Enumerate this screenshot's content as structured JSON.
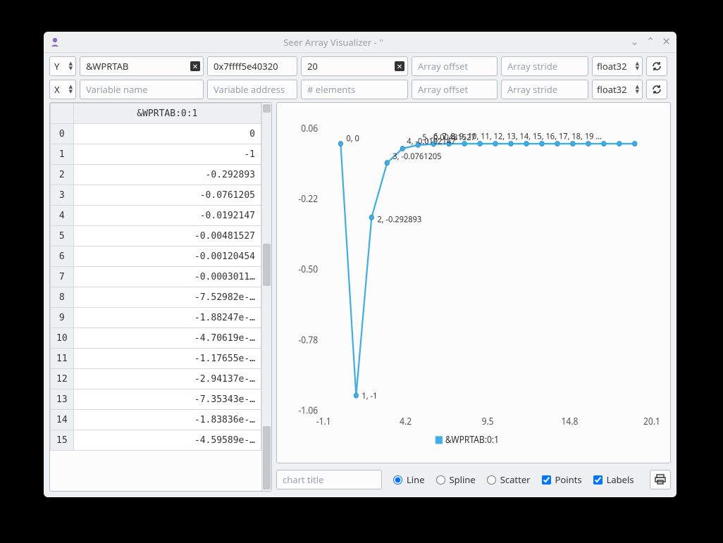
{
  "window": {
    "title": "Seer Array Visualizer - ''"
  },
  "toolbar": {
    "y": {
      "axis_label": "Y",
      "variable": "&WPRTAB",
      "address": "0x7ffff5e40320",
      "elements": "20",
      "offset_placeholder": "Array offset",
      "stride_placeholder": "Array stride",
      "dtype": "float32"
    },
    "x": {
      "axis_label": "X",
      "variable_placeholder": "Variable name",
      "address_placeholder": "Variable address",
      "elements_placeholder": "# elements",
      "offset_placeholder": "Array offset",
      "stride_placeholder": "Array stride",
      "dtype": "float32"
    }
  },
  "table": {
    "column_header": "&WPRTAB:0:1",
    "rows": [
      {
        "idx": 0,
        "val": "0"
      },
      {
        "idx": 1,
        "val": "-1"
      },
      {
        "idx": 2,
        "val": "-0.292893"
      },
      {
        "idx": 3,
        "val": "-0.0761205"
      },
      {
        "idx": 4,
        "val": "-0.0192147"
      },
      {
        "idx": 5,
        "val": "-0.00481527"
      },
      {
        "idx": 6,
        "val": "-0.00120454"
      },
      {
        "idx": 7,
        "val": "-0.0003011…"
      },
      {
        "idx": 8,
        "val": "-7.52982e-…"
      },
      {
        "idx": 9,
        "val": "-1.88247e-…"
      },
      {
        "idx": 10,
        "val": "-4.70619e-…"
      },
      {
        "idx": 11,
        "val": "-1.17655e-…"
      },
      {
        "idx": 12,
        "val": "-2.94137e-…"
      },
      {
        "idx": 13,
        "val": "-7.35343e-…"
      },
      {
        "idx": 14,
        "val": "-1.83836e-…"
      },
      {
        "idx": 15,
        "val": "-4.59589e-…"
      }
    ]
  },
  "chart": {
    "legend": "&WPRTAB:0:1",
    "x_ticks": [
      "-1.1",
      "4.2",
      "9.5",
      "14.8",
      "20.1"
    ],
    "y_ticks": [
      "0.06",
      "-0.22",
      "-0.50",
      "-0.78",
      "-1.06"
    ],
    "point_labels": [
      "0, 0",
      "1, -1",
      "2, -0.292893",
      "3, -0.0761205",
      "4, -0.0192147",
      "5, -0.00481527"
    ],
    "overlap_strip": "6, 7, 8, 9, 10, 11, 12, 13, 14, 15, 16, 17, 18, 19 …"
  },
  "bottom": {
    "chart_title_placeholder": "chart title",
    "mode_line": "Line",
    "mode_spline": "Spline",
    "mode_scatter": "Scatter",
    "cb_points": "Points",
    "cb_labels": "Labels"
  },
  "chart_data": {
    "type": "line",
    "series_name": "&WPRTAB:0:1",
    "x": [
      0,
      1,
      2,
      3,
      4,
      5,
      6,
      7,
      8,
      9,
      10,
      11,
      12,
      13,
      14,
      15,
      16,
      17,
      18,
      19
    ],
    "y": [
      0,
      -1,
      -0.292893,
      -0.0761205,
      -0.0192147,
      -0.00481527,
      -0.00120454,
      -0.0003011,
      -7.52982e-05,
      -1.88247e-05,
      -4.70619e-06,
      -1.17655e-06,
      -2.94137e-07,
      -7.35343e-08,
      -1.83836e-08,
      -4.59589e-09,
      -1.14897e-09,
      -2.87243e-10,
      -7.18108e-11,
      -1.79527e-11
    ],
    "xlim": [
      -1.1,
      20.1
    ],
    "ylim": [
      -1.06,
      0.06
    ],
    "xlabel": "",
    "ylabel": "",
    "title": "",
    "points": true,
    "labels": true
  }
}
